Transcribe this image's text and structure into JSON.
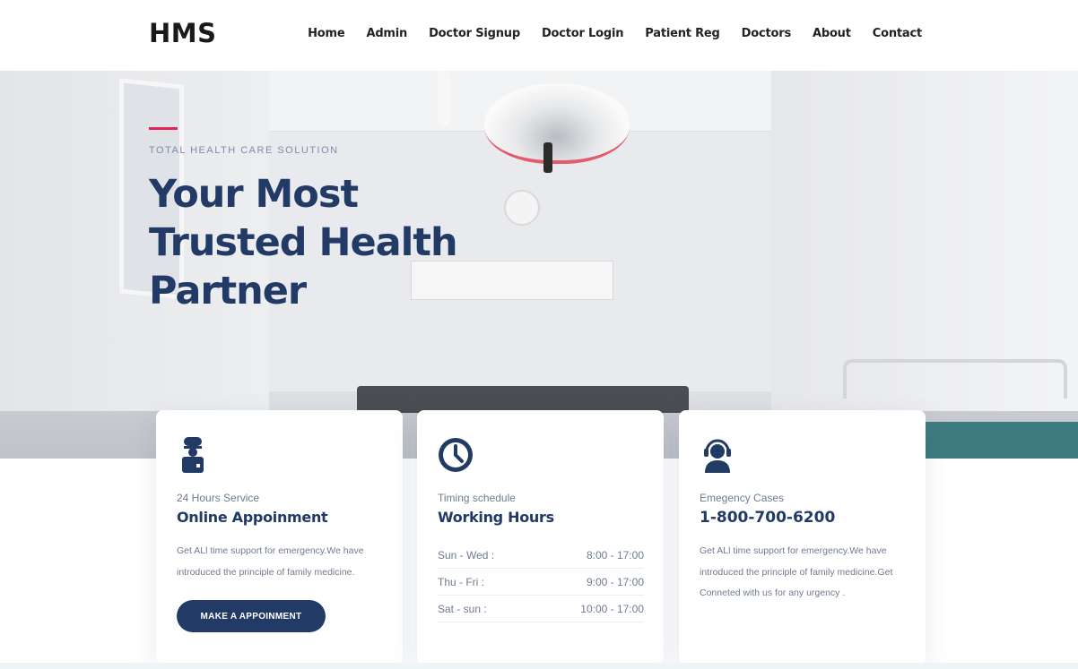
{
  "header": {
    "logo": "HMS",
    "nav": [
      "Home",
      "Admin",
      "Doctor Signup",
      "Doctor Login",
      "Patient Reg",
      "Doctors",
      "About",
      "Contact"
    ]
  },
  "hero": {
    "tagline": "TOTAL HEALTH CARE SOLUTION",
    "title": "Your Most Trusted Health Partner"
  },
  "cards": [
    {
      "icon": "doctor-icon",
      "subtitle": "24 Hours Service",
      "title": "Online Appoinment",
      "text": "Get ALl time support for emergency.We have introduced the principle of family medicine.",
      "button": "MAKE A APPOINMENT"
    },
    {
      "icon": "clock-icon",
      "subtitle": "Timing schedule",
      "title": "Working Hours",
      "hours": [
        {
          "days": "Sun - Wed :",
          "time": "8:00 - 17:00"
        },
        {
          "days": "Thu - Fri :",
          "time": "9:00 - 17:00"
        },
        {
          "days": "Sat - sun :",
          "time": "10:00 - 17:00"
        }
      ]
    },
    {
      "icon": "support-agent-icon",
      "subtitle": "Emegency Cases",
      "title": "1-800-700-6200",
      "text": "Get ALl time support for emergency.We have introduced the principle of family medicine.Get Conneted with us for any urgency ."
    }
  ],
  "colors": {
    "primary": "#223a66",
    "accent": "#e12454",
    "muted": "#6f7b8f"
  }
}
